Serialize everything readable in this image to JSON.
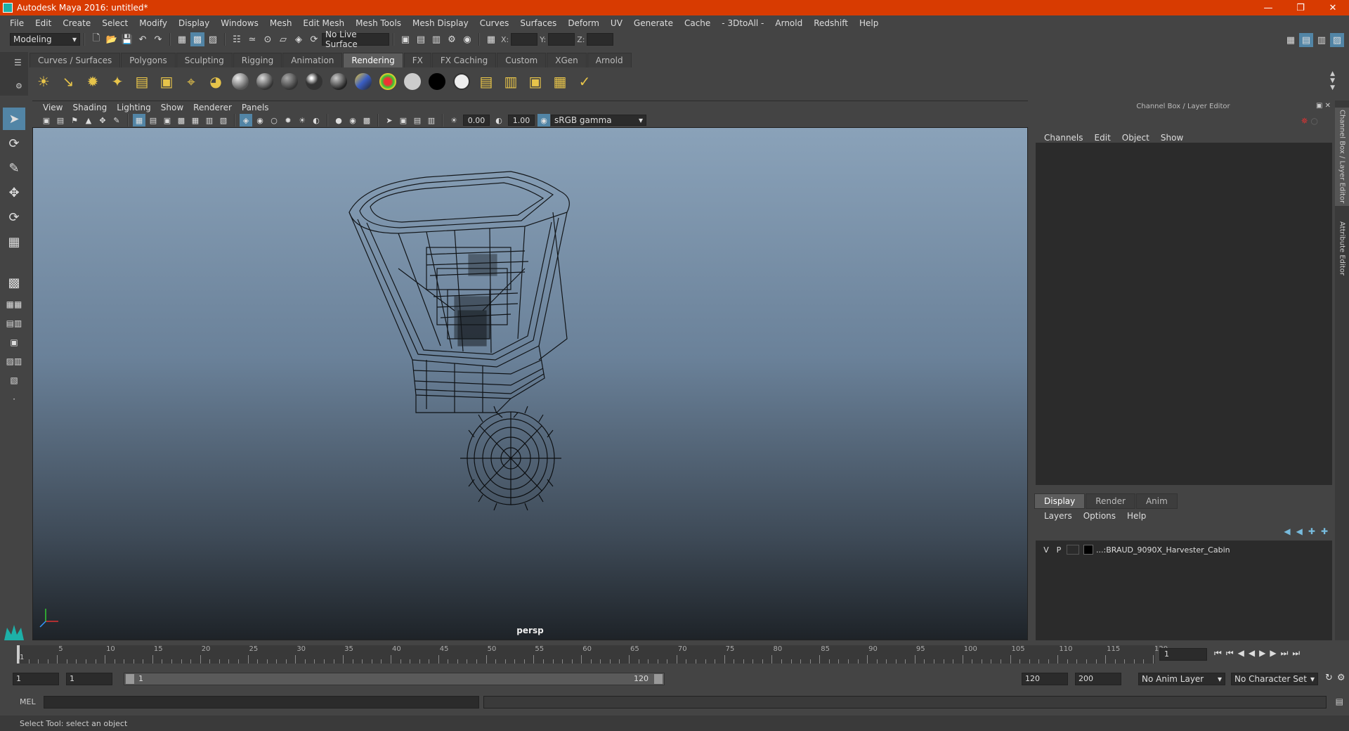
{
  "window": {
    "title": "Autodesk Maya 2016: untitled*"
  },
  "menus": [
    "File",
    "Edit",
    "Create",
    "Select",
    "Modify",
    "Display",
    "Windows",
    "Mesh",
    "Edit Mesh",
    "Mesh Tools",
    "Mesh Display",
    "Curves",
    "Surfaces",
    "Deform",
    "UV",
    "Generate",
    "Cache",
    "- 3DtoAll -",
    "Arnold",
    "Redshift",
    "Help"
  ],
  "status_line": {
    "mode": "Modeling",
    "live_surface": "No Live Surface",
    "x_label": "X:",
    "y_label": "Y:",
    "z_label": "Z:"
  },
  "shelf_tabs": [
    "Curves / Surfaces",
    "Polygons",
    "Sculpting",
    "Rigging",
    "Animation",
    "Rendering",
    "FX",
    "FX Caching",
    "Custom",
    "XGen",
    "Arnold"
  ],
  "active_shelf_tab": "Rendering",
  "viewport": {
    "menus": [
      "View",
      "Shading",
      "Lighting",
      "Show",
      "Renderer",
      "Panels"
    ],
    "exposure": "0.00",
    "gamma": "1.00",
    "color_space": "sRGB gamma",
    "camera_label": "persp"
  },
  "channel_box": {
    "title": "Channel Box / Layer Editor",
    "menus": [
      "Channels",
      "Edit",
      "Object",
      "Show"
    ]
  },
  "layer_editor": {
    "tabs": [
      "Display",
      "Render",
      "Anim"
    ],
    "active_tab": "Display",
    "menus": [
      "Layers",
      "Options",
      "Help"
    ],
    "layers": [
      {
        "v": "V",
        "p": "P",
        "name": "...:BRAUD_9090X_Harvester_Cabin"
      }
    ]
  },
  "side_tabs": [
    "Channel Box / Layer Editor",
    "Attribute Editor"
  ],
  "time_slider": {
    "ticks": [
      "5",
      "10",
      "15",
      "20",
      "25",
      "30",
      "35",
      "40",
      "45",
      "50",
      "55",
      "60",
      "65",
      "70",
      "75",
      "80",
      "85",
      "90",
      "95",
      "100",
      "105",
      "110",
      "115",
      "120"
    ],
    "start_label": "1",
    "current_frame": "1"
  },
  "range_slider": {
    "start_time": "1",
    "playback_start": "1",
    "range_start": "1",
    "range_end": "120",
    "playback_end": "120",
    "end_time": "200",
    "anim_layer": "No Anim Layer",
    "character_set": "No Character Set"
  },
  "command_line": {
    "label": "MEL"
  },
  "help_line": {
    "text": "Select Tool: select an object"
  }
}
